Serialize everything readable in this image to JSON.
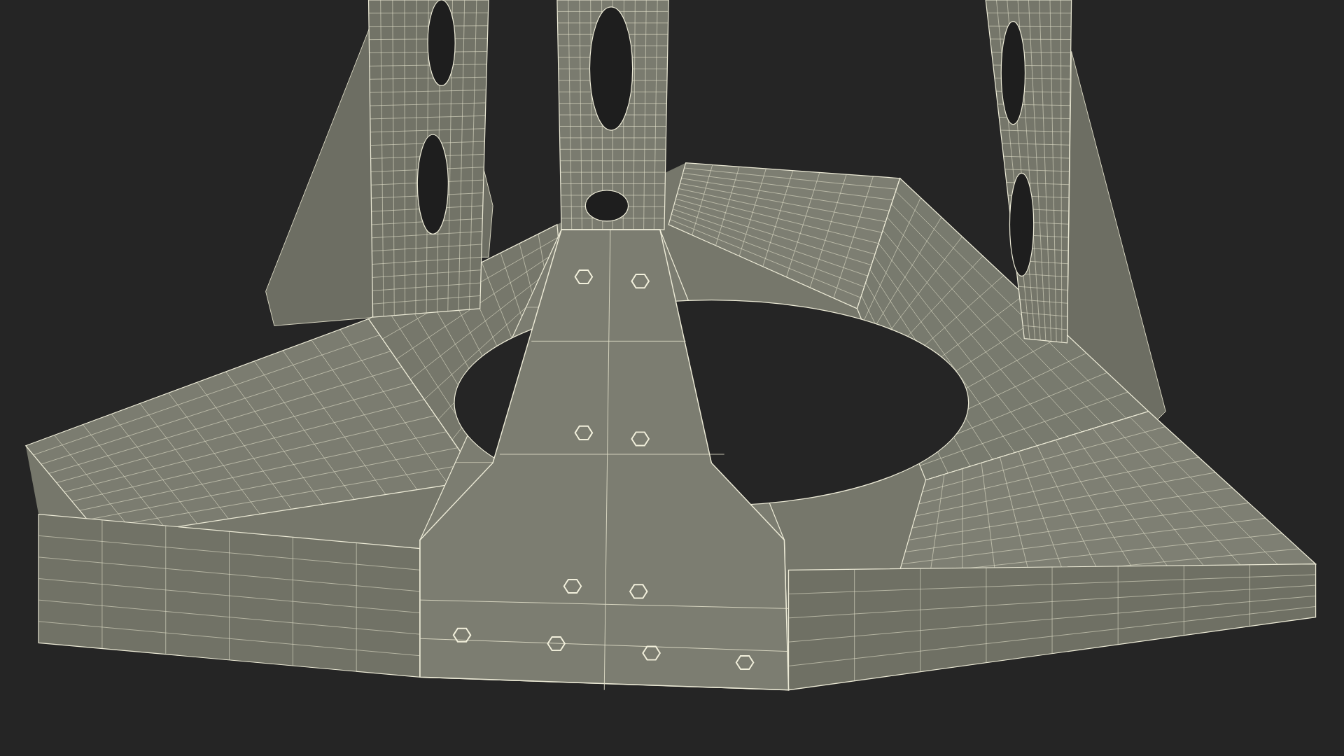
{
  "scene": {
    "kind": "wireframe"
  }
}
